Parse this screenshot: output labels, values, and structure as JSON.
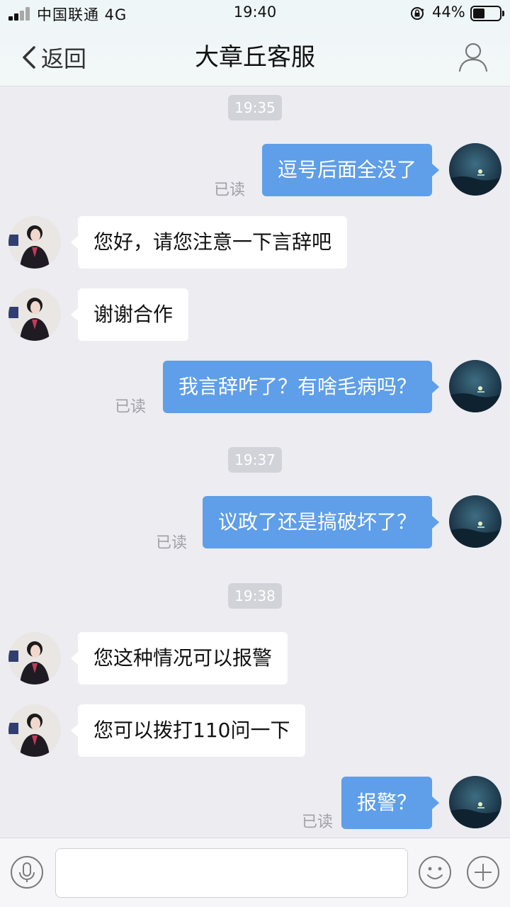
{
  "status_bar": {
    "carrier": "中国联通 4G",
    "time": "19:40",
    "battery_percent": "44%",
    "battery_level": 0.44
  },
  "nav": {
    "back_label": "返回",
    "title": "大章丘客服",
    "back_icon": "chevron-left-icon",
    "profile_icon": "person-icon"
  },
  "colors": {
    "outgoing_bubble": "#5f9ee8",
    "incoming_bubble": "#ffffff",
    "background": "#ececf1"
  },
  "read_receipt": "已读",
  "messages": [
    {
      "kind": "time",
      "text": "19:35"
    },
    {
      "kind": "out",
      "text": "逗号后面全没了",
      "status": "已读"
    },
    {
      "kind": "in",
      "text": "您好，请您注意一下言辞吧"
    },
    {
      "kind": "in",
      "text": "谢谢合作"
    },
    {
      "kind": "out",
      "text": "我言辞咋了？有啥毛病吗？",
      "status": "已读"
    },
    {
      "kind": "time",
      "text": "19:37"
    },
    {
      "kind": "out",
      "text": "议政了还是搞破坏了？",
      "status": "已读"
    },
    {
      "kind": "time",
      "text": "19:38"
    },
    {
      "kind": "in",
      "text": "您这种情况可以报警"
    },
    {
      "kind": "in",
      "text": "您可以拨打110问一下"
    },
    {
      "kind": "out",
      "text": "报警？",
      "status": "已读"
    }
  ],
  "input_bar": {
    "voice_icon": "microphone-icon",
    "emoji_icon": "smiley-icon",
    "more_icon": "plus-icon",
    "text_value": ""
  }
}
